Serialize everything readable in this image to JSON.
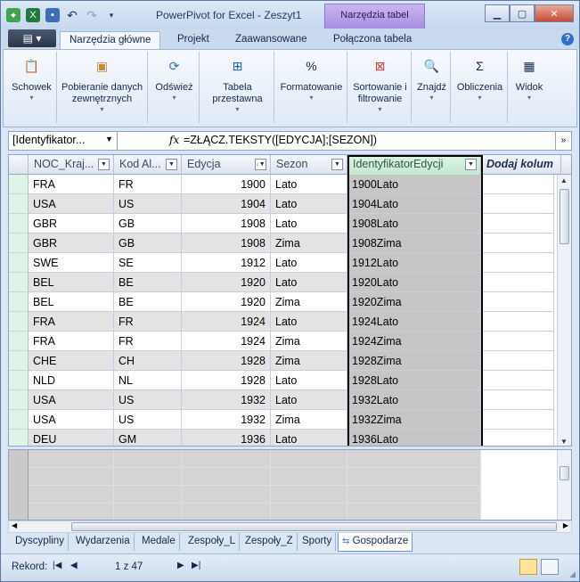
{
  "window": {
    "title": "PowerPivot for Excel - Zeszyt1",
    "context_tab": "Narzędzia tabel"
  },
  "ribbon_tabs": [
    "Narzędzia główne",
    "Projekt",
    "Zaawansowane",
    "Połączona tabela"
  ],
  "ribbon_groups": [
    {
      "label": "Schowek"
    },
    {
      "label": "Pobieranie danych zewnętrznych"
    },
    {
      "label": "Odśwież"
    },
    {
      "label": "Tabela przestawna"
    },
    {
      "label": "Formatowanie"
    },
    {
      "label": "Sortowanie i filtrowanie"
    },
    {
      "label": "Znajdź"
    },
    {
      "label": "Obliczenia"
    },
    {
      "label": "Widok"
    }
  ],
  "formula_bar": {
    "name_box": "[Identyfikator...",
    "fx": "fx",
    "formula": "=ZŁĄCZ.TEKSTY([EDYCJA];[SEZON])"
  },
  "columns": [
    "NOC_Kraj...",
    "Kod Al...",
    "Edycja",
    "Sezon",
    "IdentyfikatorEdycji",
    "Dodaj kolum"
  ],
  "rows": [
    [
      "FRA",
      "FR",
      "1900",
      "Lato",
      "1900Lato"
    ],
    [
      "USA",
      "US",
      "1904",
      "Lato",
      "1904Lato"
    ],
    [
      "GBR",
      "GB",
      "1908",
      "Lato",
      "1908Lato"
    ],
    [
      "GBR",
      "GB",
      "1908",
      "Zima",
      "1908Zima"
    ],
    [
      "SWE",
      "SE",
      "1912",
      "Lato",
      "1912Lato"
    ],
    [
      "BEL",
      "BE",
      "1920",
      "Lato",
      "1920Lato"
    ],
    [
      "BEL",
      "BE",
      "1920",
      "Zima",
      "1920Zima"
    ],
    [
      "FRA",
      "FR",
      "1924",
      "Lato",
      "1924Lato"
    ],
    [
      "FRA",
      "FR",
      "1924",
      "Zima",
      "1924Zima"
    ],
    [
      "CHE",
      "CH",
      "1928",
      "Zima",
      "1928Zima"
    ],
    [
      "NLD",
      "NL",
      "1928",
      "Lato",
      "1928Lato"
    ],
    [
      "USA",
      "US",
      "1932",
      "Lato",
      "1932Lato"
    ],
    [
      "USA",
      "US",
      "1932",
      "Zima",
      "1932Zima"
    ],
    [
      "DEU",
      "GM",
      "1936",
      "Lato",
      "1936Lato"
    ]
  ],
  "sheet_tabs": [
    "Dyscypliny",
    "Wydarzenia",
    "Medale",
    "Zespoły_L",
    "Zespoły_Z",
    "Sporty",
    "Gospodarze"
  ],
  "active_sheet": "Gospodarze",
  "status": {
    "record_label": "Rekord:",
    "position": "1 z 47"
  }
}
